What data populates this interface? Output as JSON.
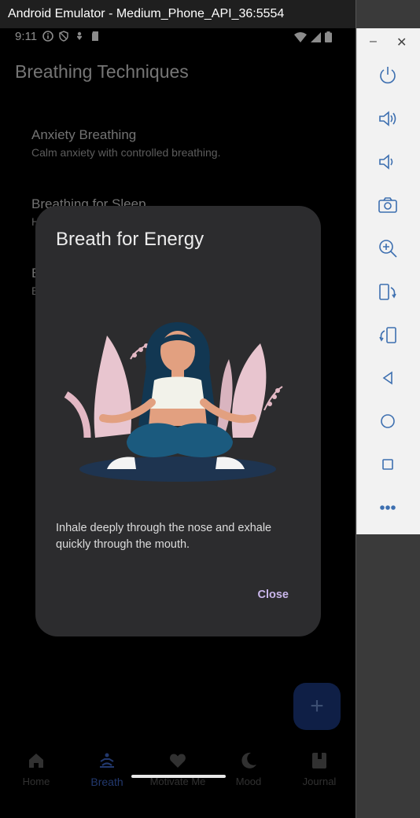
{
  "emulator": {
    "window_title": "Android Emulator - Medium_Phone_API_36:5554",
    "minimize": "–",
    "close": "✕",
    "toolbar": [
      "power-icon",
      "volume-up-icon",
      "volume-down-icon",
      "camera-icon",
      "zoom-icon",
      "rotate-left-icon",
      "rotate-right-icon",
      "back-icon",
      "home-icon",
      "overview-icon",
      "more-icon"
    ]
  },
  "status": {
    "time": "9:11"
  },
  "app": {
    "title": "Breathing Techniques",
    "items": [
      {
        "title": "Anxiety Breathing",
        "subtitle": "Calm anxiety with controlled breathing."
      },
      {
        "title": "Breathing for Sleep",
        "subtitle": "H"
      },
      {
        "title": "B",
        "subtitle": "E"
      }
    ]
  },
  "dialog": {
    "title": "Breath for Energy",
    "body": "Inhale deeply through the nose and exhale quickly through the mouth.",
    "close_label": "Close"
  },
  "fab": {
    "label": "+"
  },
  "nav": {
    "items": [
      {
        "label": "Home",
        "icon": "home-icon"
      },
      {
        "label": "Breath",
        "icon": "meditation-icon"
      },
      {
        "label": "Motivate Me",
        "icon": "heart-icon"
      },
      {
        "label": "Mood",
        "icon": "moon-icon"
      },
      {
        "label": "Journal",
        "icon": "journal-icon"
      }
    ],
    "active": "Breath"
  },
  "colors": {
    "accent": "#3f67c6",
    "dialog_bg": "#2c2c2e",
    "close_text": "#c9b6ea"
  }
}
